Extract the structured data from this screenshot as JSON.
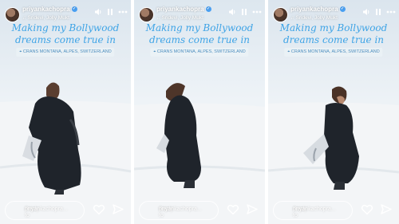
{
  "story_panels": [
    {
      "username": "priyankachopra",
      "music": "Sridevi, Jolly Mukt",
      "caption_line1": "Making my Bollywood",
      "caption_line2": "dreams come true in",
      "location": "CRANS MONTANA, ALPES, SWITZERLAND",
      "reply_line1": "Reply to",
      "reply_line2": "priyankachopra..."
    },
    {
      "username": "priyankachopra",
      "music": "Sridevi, Jolly Mukt",
      "caption_line1": "Making my Bollywood",
      "caption_line2": "dreams come true in",
      "location": "CRANS MONTANA, ALPES, SWITZERLAND",
      "reply_line1": "Reply to",
      "reply_line2": "priyankachopra..."
    },
    {
      "username": "priyankachopra",
      "music": "Sridevi, Jolly Mukt",
      "caption_line1": "Making my Bollywood",
      "caption_line2": "dreams come true in",
      "location": "CRANS MONTANA, ALPES, SWITZERLAND",
      "reply_line1": "Reply to",
      "reply_line2": "priyankachopra..."
    }
  ],
  "colors": {
    "caption": "#3fa4e6",
    "sky": "#e9eff4",
    "snow": "#f4f6f8",
    "coat": "#1f242b"
  },
  "icons": [
    "verified-icon",
    "music-note-icon",
    "volume-icon",
    "pause-icon",
    "more-icon",
    "heart-icon",
    "send-icon"
  ]
}
